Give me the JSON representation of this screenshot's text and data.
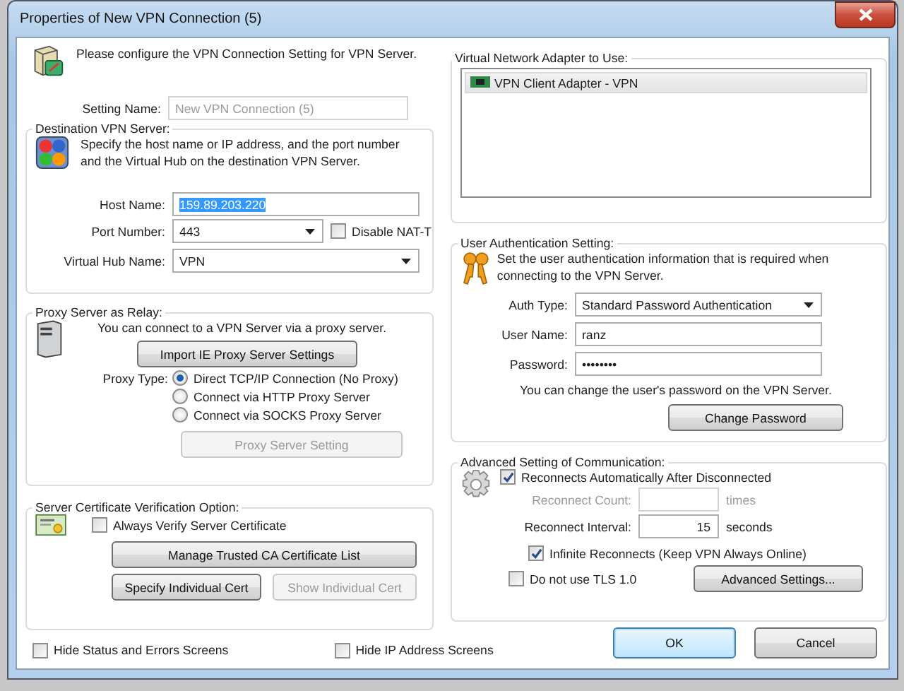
{
  "window": {
    "title": "Properties of New VPN Connection (5)"
  },
  "header": "Please configure the VPN Connection Setting for VPN Server.",
  "setting_name": {
    "label": "Setting Name:",
    "value": "New VPN Connection (5)",
    "disabled": true
  },
  "destination": {
    "title": "Destination VPN Server:",
    "description": "Specify the host name or IP address, and the port number and the Virtual Hub on the destination VPN Server.",
    "host_name": {
      "label": "Host Name:",
      "value": "159.89.203.220",
      "selected": true
    },
    "port": {
      "label": "Port Number:",
      "value": "443"
    },
    "disable_nat_t": {
      "label": "Disable NAT-T",
      "checked": false
    },
    "hub": {
      "label": "Virtual Hub Name:",
      "value": "VPN"
    }
  },
  "proxy": {
    "title": "Proxy Server as Relay:",
    "description": "You can connect to a VPN Server via a proxy server.",
    "import_button": "Import IE Proxy Server Settings",
    "type_label": "Proxy Type:",
    "options": [
      {
        "label": "Direct TCP/IP Connection (No Proxy)",
        "selected": true
      },
      {
        "label": "Connect via HTTP Proxy Server",
        "selected": false
      },
      {
        "label": "Connect via SOCKS Proxy Server",
        "selected": false
      }
    ],
    "setting_button": {
      "label": "Proxy Server Setting",
      "disabled": true
    }
  },
  "certificate": {
    "title": "Server Certificate Verification Option:",
    "always_verify": {
      "label": "Always Verify Server Certificate",
      "checked": false
    },
    "manage_button": {
      "label": "Manage Trusted CA Certificate List",
      "disabled": false
    },
    "specify_button": {
      "label": "Specify Individual Cert",
      "disabled": false
    },
    "show_button": {
      "label": "Show Individual Cert",
      "disabled": true
    }
  },
  "bottom_checks": [
    {
      "label": "Hide Status and Errors Screens",
      "checked": false
    },
    {
      "label": "Hide IP Address Screens",
      "checked": false
    }
  ],
  "adapter": {
    "title": "Virtual Network Adapter to Use:",
    "items": [
      {
        "label": "VPN Client Adapter - VPN",
        "selected": true
      }
    ]
  },
  "auth": {
    "title": "User Authentication Setting:",
    "description": "Set the user authentication information that is required when connecting to the VPN Server.",
    "auth_type": {
      "label": "Auth Type:",
      "value": "Standard Password Authentication"
    },
    "user_name": {
      "label": "User Name:",
      "value": "ranz"
    },
    "password": {
      "label": "Password:",
      "value": "••••••••"
    },
    "note": "You can change the user's password on the VPN Server.",
    "change_button": {
      "label": "Change Password",
      "disabled": false
    }
  },
  "advanced": {
    "title": "Advanced Setting of Communication:",
    "reconnect": {
      "label": "Reconnects Automatically After Disconnected",
      "checked": true
    },
    "count": {
      "label": "Reconnect Count:",
      "unit": "times",
      "disabled": true
    },
    "interval": {
      "label": "Reconnect Interval:",
      "value": "15",
      "unit": "seconds",
      "disabled": false
    },
    "infinite": {
      "label": "Infinite Reconnects (Keep VPN Always Online)",
      "checked": true
    },
    "tls": {
      "label": "Do not use TLS 1.0",
      "checked": false
    },
    "advanced_button": {
      "label": "Advanced Settings...",
      "disabled": false
    }
  },
  "buttons": [
    {
      "label": "OK",
      "kind": "default"
    },
    {
      "label": "Cancel",
      "kind": "normal"
    }
  ]
}
